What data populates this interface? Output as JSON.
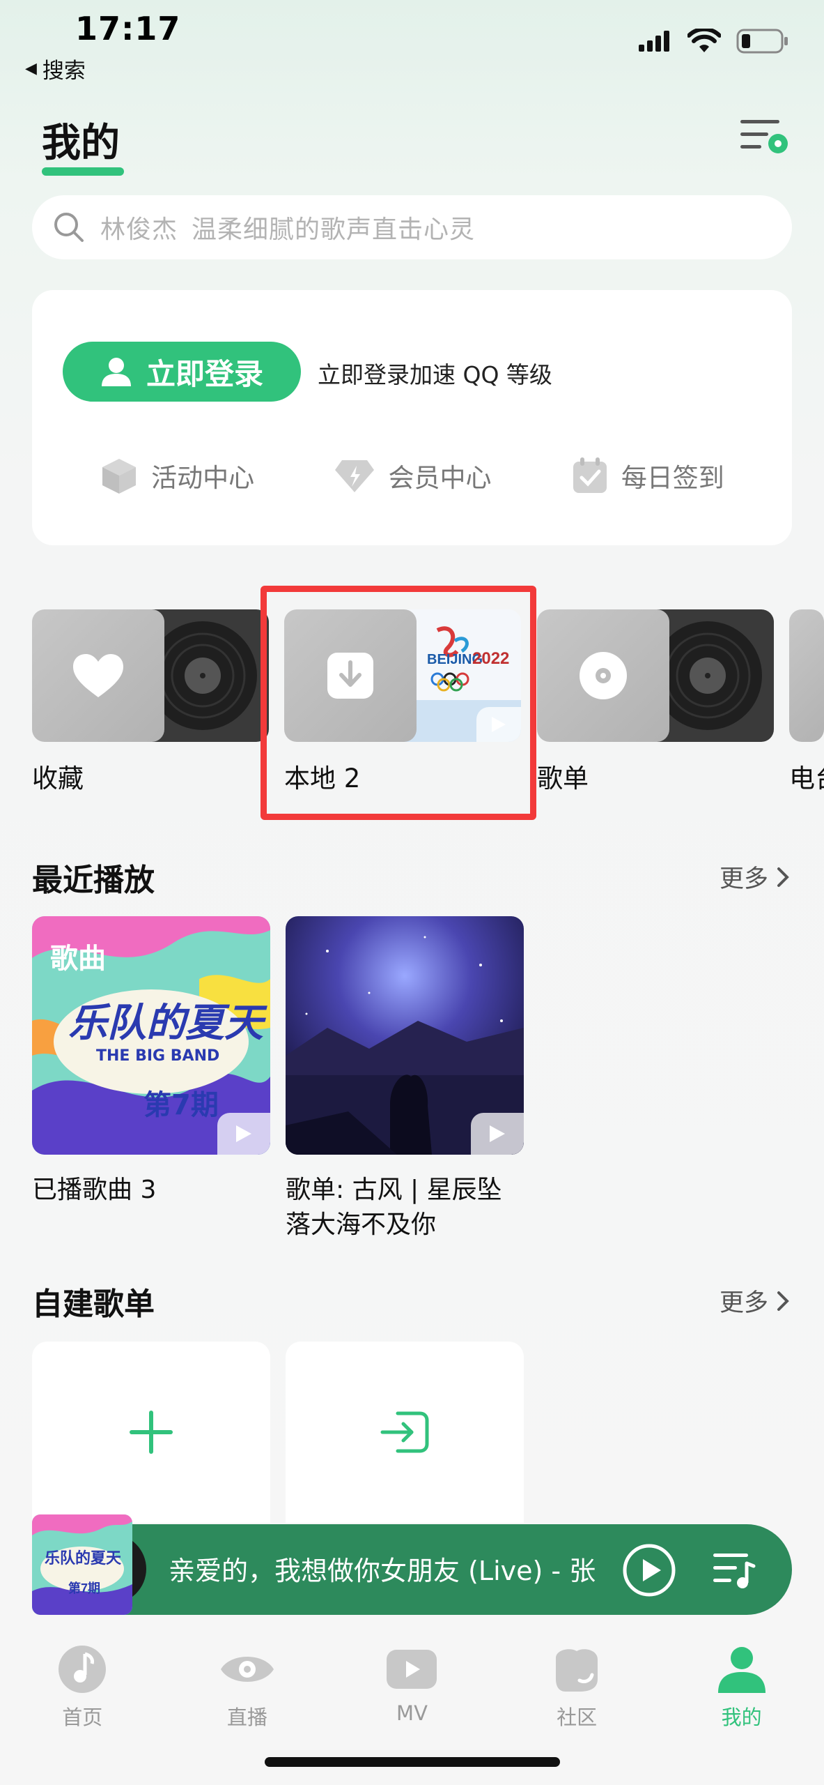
{
  "status_bar": {
    "time": "17:17",
    "back_label": "搜索"
  },
  "header": {
    "title": "我的"
  },
  "search": {
    "placeholder_artist": "林俊杰",
    "placeholder_desc": "温柔细腻的歌声直击心灵"
  },
  "login": {
    "button_label": "立即登录",
    "tip": "立即登录加速 QQ 等级",
    "quick_links": [
      {
        "label": "活动中心",
        "icon": "cube-icon"
      },
      {
        "label": "会员中心",
        "icon": "vip-diamond-icon"
      },
      {
        "label": "每日签到",
        "icon": "calendar-check-icon"
      }
    ]
  },
  "library_tiles": [
    {
      "label": "收藏",
      "icon": "heart-icon"
    },
    {
      "label": "本地 2",
      "icon": "download-icon"
    },
    {
      "label": "歌单",
      "icon": "disc-icon"
    },
    {
      "label": "电台",
      "icon": "radio-icon"
    }
  ],
  "recent": {
    "title": "最近播放",
    "more_label": "更多",
    "items": [
      {
        "caption": "已播歌曲 3",
        "badge": "歌曲",
        "art_line1": "乐队的夏天",
        "art_line2": "THE BIG BAND",
        "art_line3": "第7期"
      },
      {
        "caption": "歌单: 古风 | 星辰坠落大海不及你"
      }
    ]
  },
  "playlists": {
    "title": "自建歌单",
    "more_label": "更多"
  },
  "player": {
    "now_playing": "亲爱的，我想做你女朋友 (Live) - 张"
  },
  "tabs": [
    {
      "label": "首页",
      "icon": "home-note-icon",
      "active": false
    },
    {
      "label": "直播",
      "icon": "eye-icon",
      "active": false
    },
    {
      "label": "MV",
      "icon": "video-play-icon",
      "active": false
    },
    {
      "label": "社区",
      "icon": "community-icon",
      "active": false
    },
    {
      "label": "我的",
      "icon": "profile-icon",
      "active": true
    }
  ],
  "colors": {
    "accent": "#31c27c",
    "player_bg": "#2d8a5c",
    "highlight": "#f23a3a"
  }
}
